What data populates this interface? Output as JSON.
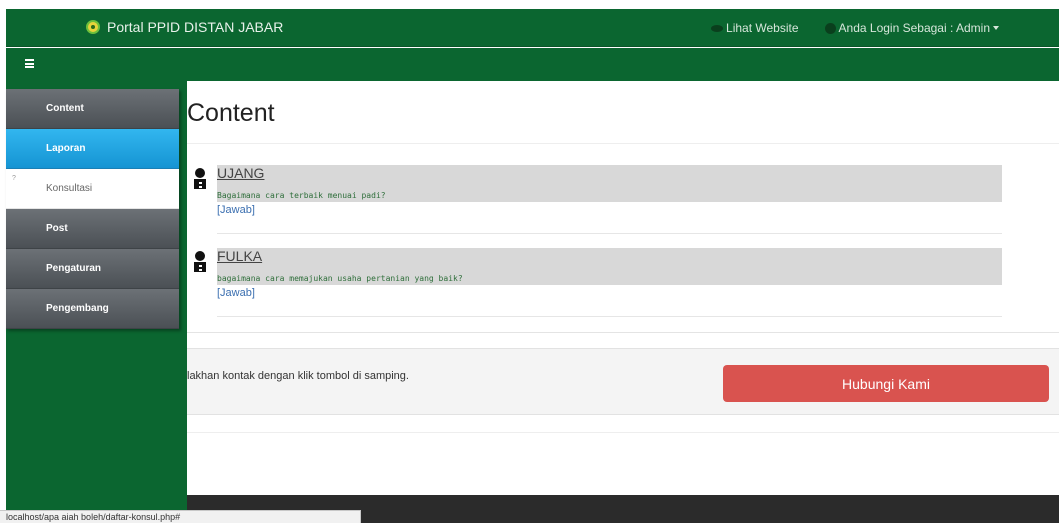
{
  "header": {
    "brand": "Portal PPID DISTAN JABAR",
    "view_website": "Lihat Website",
    "login_as": "Anda Login Sebagai : Admin"
  },
  "sidebar": {
    "items": [
      {
        "label": "Content",
        "state": "normal"
      },
      {
        "label": "Laporan",
        "state": "active"
      },
      {
        "label": "Konsultasi",
        "state": "submenu"
      },
      {
        "label": "Post",
        "state": "normal"
      },
      {
        "label": "Pengaturan",
        "state": "normal"
      },
      {
        "label": "Pengembang",
        "state": "normal"
      }
    ],
    "submenu_marker": "?"
  },
  "main": {
    "title": "Content",
    "entries": [
      {
        "name": "UJANG",
        "question": "Bagaimana cara terbaik menuai padi?",
        "action": "[Jawab]"
      },
      {
        "name": "FULKA",
        "question": "bagaimana cara memajukan usaha pertanian yang baik?",
        "action": "[Jawab]"
      }
    ]
  },
  "contact": {
    "text": "lakhan kontak dengan klik tombol di samping.",
    "button": "Hubungi Kami"
  },
  "status_bar": {
    "url": "localhost/apa aiah boleh/daftar-konsul.php#"
  },
  "colors": {
    "nav_green": "#0b6630",
    "active_blue": "#1594d3",
    "button_red": "#d9534f",
    "footer_dark": "#2b2b2b"
  }
}
